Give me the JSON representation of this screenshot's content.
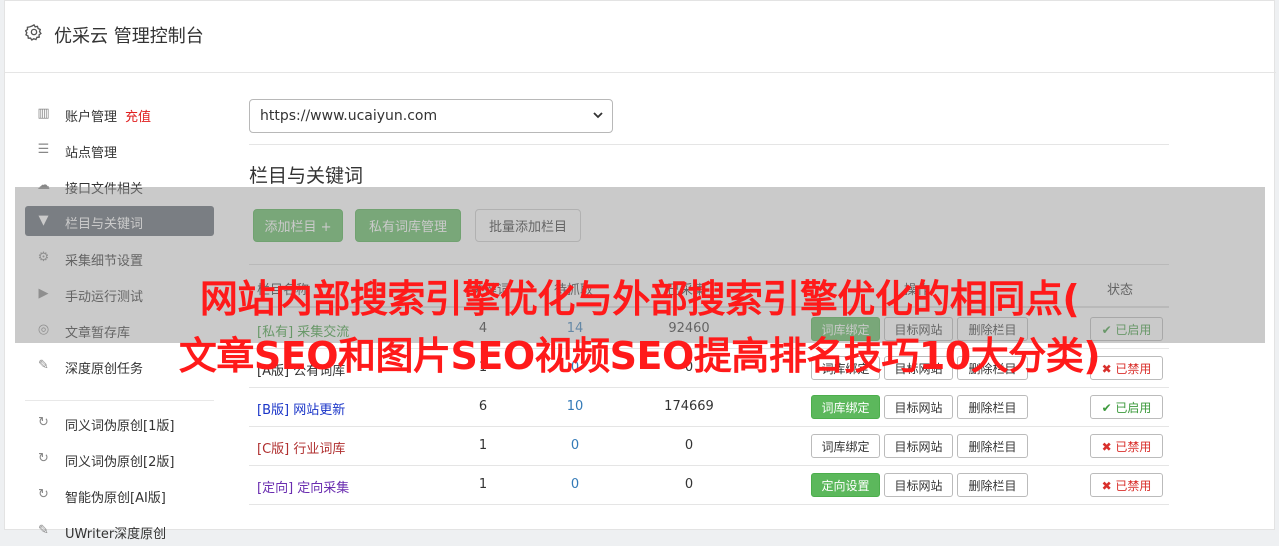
{
  "header": {
    "title": "优采云 管理控制台",
    "icon": "gear-icon"
  },
  "sidebar": {
    "items": [
      {
        "label": "账户管理",
        "extra": "充值",
        "icon": "bar-chart-icon"
      },
      {
        "label": "站点管理",
        "icon": "server-icon"
      },
      {
        "label": "接口文件相关",
        "icon": "cloud-upload-icon"
      },
      {
        "label": "栏目与关键词",
        "icon": "filter-icon",
        "active": true
      },
      {
        "label": "采集细节设置",
        "icon": "cogs-icon"
      },
      {
        "label": "手动运行测试",
        "icon": "play-circle-icon"
      },
      {
        "label": "文章暂存库",
        "icon": "database-icon"
      },
      {
        "label": "深度原创任务",
        "icon": "edit-icon"
      },
      {
        "label": "同义词伪原创[1版]",
        "icon": "refresh-icon"
      },
      {
        "label": "同义词伪原创[2版]",
        "icon": "refresh-icon"
      },
      {
        "label": "智能伪原创[AI版]",
        "icon": "refresh-icon"
      },
      {
        "label": "UWriter深度原创",
        "icon": "edit-icon"
      }
    ]
  },
  "main": {
    "site_select": "https://www.ucaiyun.com",
    "section_title": "栏目与关键词",
    "buttons": {
      "add_column": "添加栏目 +",
      "private_lib": "私有词库管理",
      "batch_add": "批量添加栏目"
    },
    "table": {
      "headers": [
        "栏目名称",
        "关键词",
        "待抓取",
        "已采集",
        "操作",
        "状态"
      ],
      "rows": [
        {
          "tag": "[私有]",
          "name": "采集交流",
          "color": "#3a9a3a",
          "kw": "4",
          "pending": "14",
          "collected": "92460",
          "btn1": "词库绑定",
          "btn1_green": true,
          "btn2": "目标网站",
          "btn3": "删除栏目",
          "status": "✔ 已启用",
          "status_ok": true
        },
        {
          "tag": "[A版]",
          "name": "公有词库",
          "color": "#333333",
          "kw": "1",
          "pending": "0",
          "collected": "0",
          "btn1": "词库绑定",
          "btn1_green": false,
          "btn2": "目标网站",
          "btn3": "删除栏目",
          "status": "✖ 已禁用",
          "status_ok": false
        },
        {
          "tag": "[B版]",
          "name": "网站更新",
          "color": "#1a35c8",
          "kw": "6",
          "pending": "10",
          "collected": "174669",
          "btn1": "词库绑定",
          "btn1_green": true,
          "btn2": "目标网站",
          "btn3": "删除栏目",
          "status": "✔ 已启用",
          "status_ok": true
        },
        {
          "tag": "[C版]",
          "name": "行业词库",
          "color": "#b03030",
          "kw": "1",
          "pending": "0",
          "collected": "0",
          "btn1": "词库绑定",
          "btn1_green": false,
          "btn2": "目标网站",
          "btn3": "删除栏目",
          "status": "✖ 已禁用",
          "status_ok": false
        },
        {
          "tag": "[定向]",
          "name": "定向采集",
          "color": "#6a2db0",
          "kw": "1",
          "pending": "0",
          "collected": "0",
          "btn1": "定向设置",
          "btn1_green": true,
          "btn2": "目标网站",
          "btn3": "删除栏目",
          "status": "✖ 已禁用",
          "status_ok": false
        }
      ]
    }
  },
  "watermark": {
    "line1": "网站内部搜索引擎优化与外部搜索引擎优化的相同点(",
    "line2": "文章SEO和图片SEO视频SEO提高排名技巧10大分类)"
  }
}
